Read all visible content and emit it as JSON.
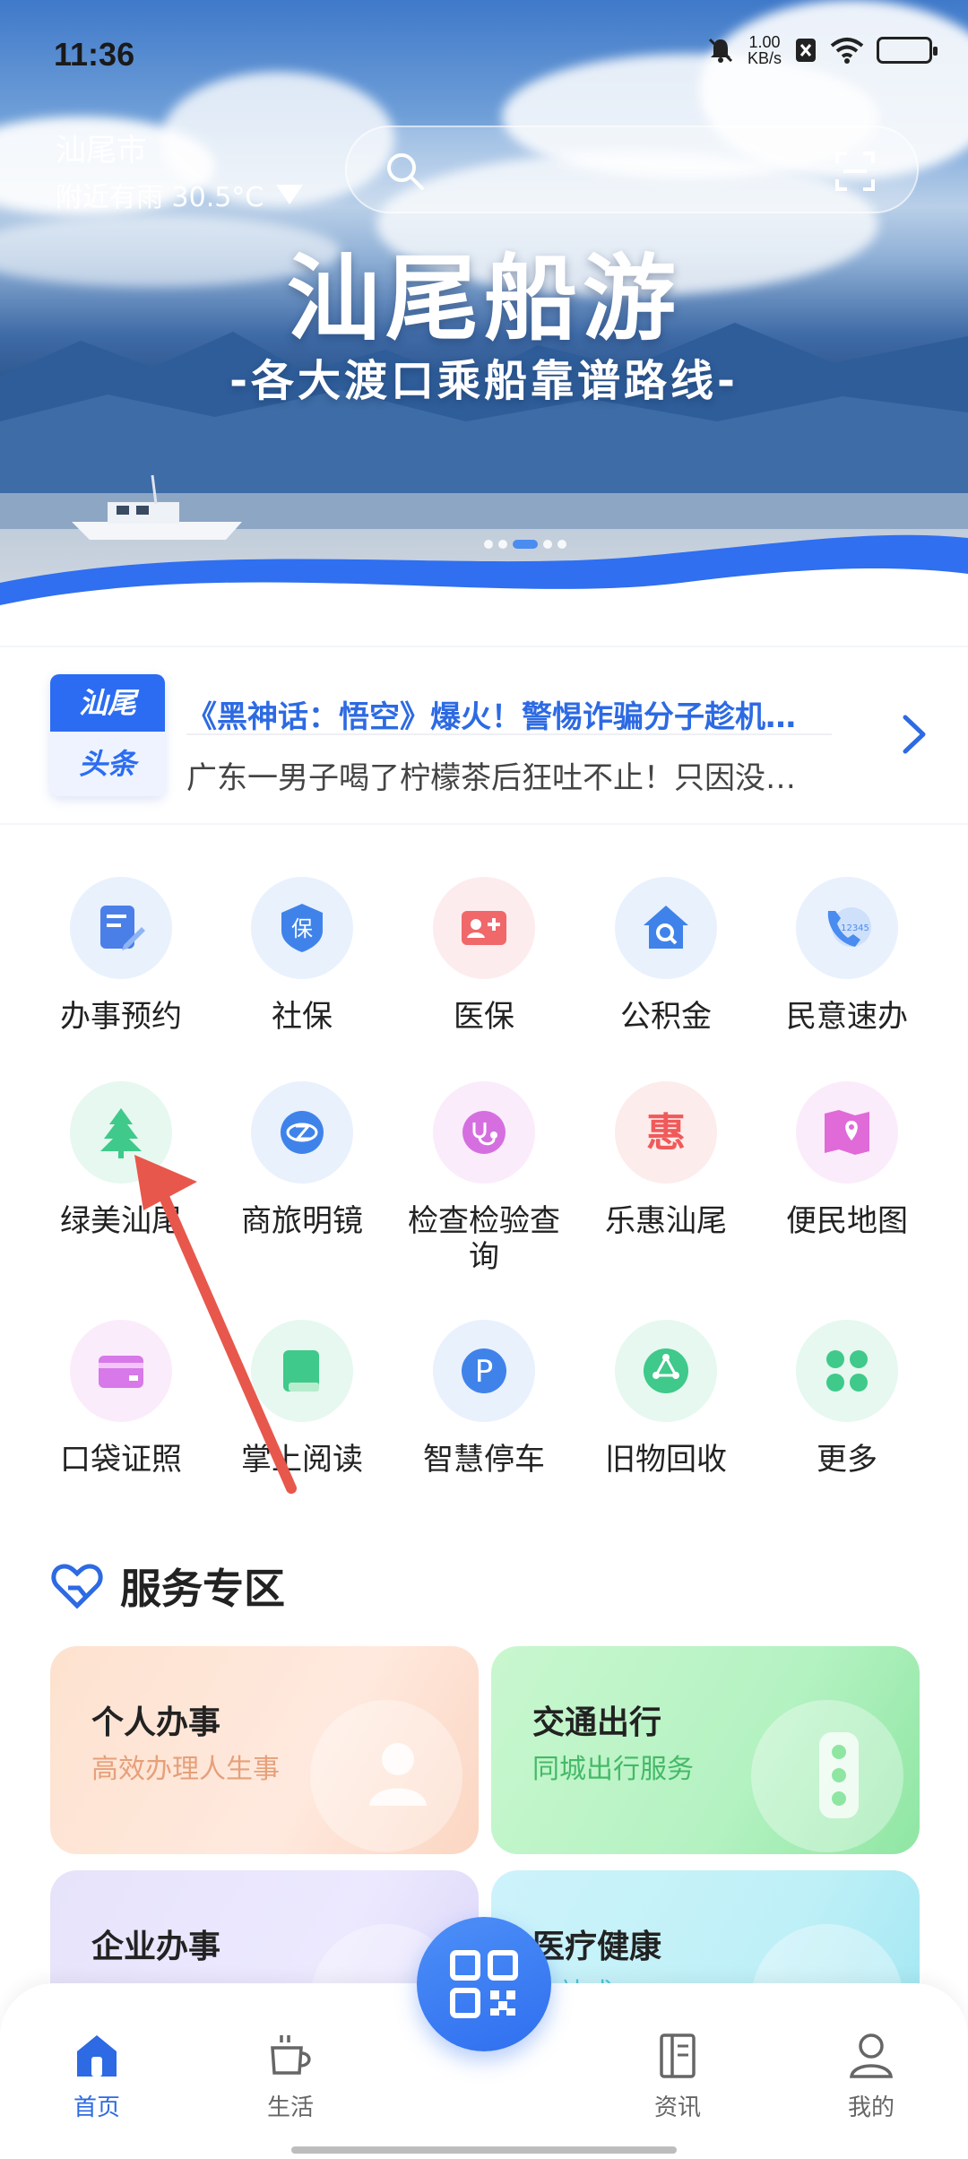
{
  "status_bar": {
    "time": "11:36",
    "net_speed_value": "1.00",
    "net_speed_unit": "KB/s"
  },
  "header": {
    "city": "汕尾市",
    "weather": "附近有雨 30.5°C"
  },
  "banner": {
    "title": "汕尾船游",
    "subtitle": "-各大渡口乘船靠谱路线-",
    "page_index": 3,
    "page_count": 5
  },
  "news": {
    "badge_line1": "汕尾",
    "badge_line2": "头条",
    "headline_1": "《黑神话：悟空》爆火！警惕诈骗分子趁机…",
    "headline_2": "广东一男子喝了柠檬茶后狂吐不止！只因没…"
  },
  "services_grid": [
    {
      "label": "办事预约",
      "icon": "form-edit-icon",
      "color": "#4a7fe8"
    },
    {
      "label": "社保",
      "icon": "shield-bao-icon",
      "color": "#3f83ea"
    },
    {
      "label": "医保",
      "icon": "medical-card-icon",
      "color": "#f0686a"
    },
    {
      "label": "公积金",
      "icon": "house-search-icon",
      "color": "#3f83ea"
    },
    {
      "label": "民意速办",
      "icon": "phone-12345-icon",
      "color": "#4a8cf0"
    },
    {
      "label": "绿美汕尾",
      "icon": "tree-icon",
      "color": "#3fc98a"
    },
    {
      "label": "商旅明镜",
      "icon": "disc-icon",
      "color": "#3f83ea"
    },
    {
      "label": "检查检验查询",
      "icon": "stethoscope-icon",
      "color": "#d56fe0"
    },
    {
      "label": "乐惠汕尾",
      "icon": "hui-icon",
      "color": "#f05a5a"
    },
    {
      "label": "便民地图",
      "icon": "map-pin-icon",
      "color": "#e06ad8"
    },
    {
      "label": "口袋证照",
      "icon": "card-icon",
      "color": "#d779e8"
    },
    {
      "label": "掌上阅读",
      "icon": "book-icon",
      "color": "#3fc98a"
    },
    {
      "label": "智慧停车",
      "icon": "parking-icon",
      "color": "#3f83ea"
    },
    {
      "label": "旧物回收",
      "icon": "recycle-icon",
      "color": "#3fc98a"
    },
    {
      "label": "更多",
      "icon": "clover-more-icon",
      "color": "#3fc98a"
    }
  ],
  "service_zone": {
    "title": "服务专区",
    "cards": [
      {
        "title": "个人办事",
        "subtitle": "高效办理人生事"
      },
      {
        "title": "交通出行",
        "subtitle": "同城出行服务"
      },
      {
        "title": "企业办事",
        "subtitle": ""
      },
      {
        "title": "医疗健康",
        "subtitle": "一站式"
      }
    ]
  },
  "tabbar": {
    "tabs": [
      {
        "label": "首页",
        "icon": "home-icon",
        "active": true
      },
      {
        "label": "生活",
        "icon": "cup-icon",
        "active": false
      },
      {
        "label": "资讯",
        "icon": "news-icon",
        "active": false
      },
      {
        "label": "我的",
        "icon": "user-icon",
        "active": false
      }
    ],
    "center_icon": "qr-code-icon"
  },
  "colors": {
    "accent": "#2d6ae3",
    "annotation_arrow": "#e8574c"
  }
}
